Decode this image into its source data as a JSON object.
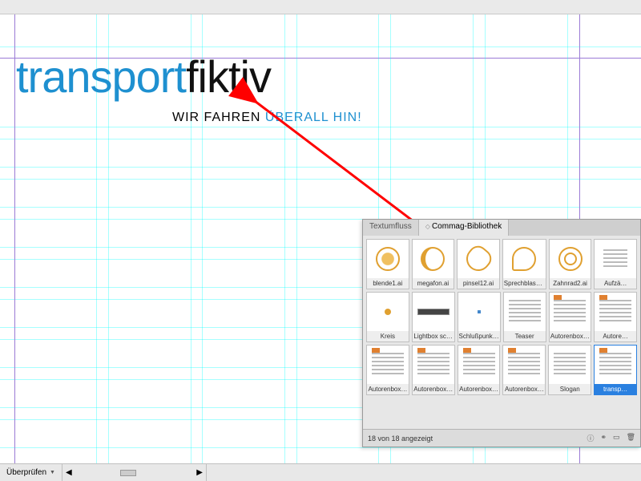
{
  "logo": {
    "part1": "transport",
    "part2": "fiktiv"
  },
  "tagline": {
    "part1": "WIR FAHREN ",
    "part2": "ÜBERALL HIN!"
  },
  "panel": {
    "tabs": [
      {
        "label": "Textumfluss",
        "active": false
      },
      {
        "label": "Commag-Bibliothek",
        "active": true,
        "diamond": "◇"
      }
    ],
    "items": [
      [
        {
          "label": "blende1.ai",
          "icon": "aperture"
        },
        {
          "label": "megafon.ai",
          "icon": "megaphone"
        },
        {
          "label": "pinsel12.ai",
          "icon": "brush"
        },
        {
          "label": "Sprechblase.ai",
          "icon": "speech"
        },
        {
          "label": "Zahnrad2.ai",
          "icon": "gear"
        },
        {
          "label": "Aufzä…",
          "icon": "list"
        }
      ],
      [
        {
          "label": "Kreis",
          "icon": "dot"
        },
        {
          "label": "Lightbox sc…",
          "icon": "bar"
        },
        {
          "label": "Schlußpunk…",
          "icon": "bluedot"
        },
        {
          "label": "Teaser",
          "icon": "lines"
        },
        {
          "label": "Autorenbox…",
          "icon": "taglines"
        },
        {
          "label": "Autore…",
          "icon": "taglines"
        }
      ],
      [
        {
          "label": "Autorenbox…",
          "icon": "taglines"
        },
        {
          "label": "Autorenbox…",
          "icon": "taglines"
        },
        {
          "label": "Autorenbox…",
          "icon": "taglines"
        },
        {
          "label": "Autorenbox…",
          "icon": "taglines"
        },
        {
          "label": "Slogan",
          "icon": "lines"
        },
        {
          "label": "transp…",
          "icon": "taglines",
          "selected": true
        }
      ]
    ],
    "status": "18 von 18 angezeigt"
  },
  "status_bar": {
    "label": "Überprüfen"
  }
}
